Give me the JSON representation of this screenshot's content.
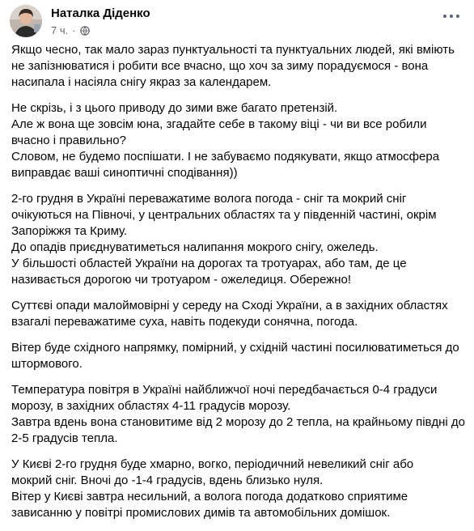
{
  "post": {
    "author": "Наталка Діденко",
    "time": "7 ч.",
    "separator": "·",
    "paragraphs": [
      [
        "Якщо чесно, так мало зараз пунктуальності та пунктуальних людей, які вміють",
        "не запізнюватися і робити все вчасно, що хоч за зиму порадуємося - вона",
        "насипала і насіяла снігу якраз за календарем."
      ],
      [
        "Не скрізь, і з цього приводу до зими вже багато претензій.",
        "Але ж вона ще зовсім юна, згадайте себе в такому віці - чи ви все робили",
        "вчасно і правильно?",
        "Словом, не будемо поспішати. І не забуваємо подякувати, якщо атмосфера",
        "виправдає ваші синоптичні сподівання))"
      ],
      [
        "2-го грудня в Україні переважатиме волога погода - сніг та мокрий сніг",
        "очікуються на Півночі, у центральних областях та у південній частині, окрім",
        "Запоріжжя та Криму.",
        "До опадів приєднуватиметься налипання мокрого снігу, ожеледь.",
        "У більшості областей України на дорогах та тротуарах, або там, де це",
        "називається дорогою чи тротуаром - ожеледиця. Обережно!"
      ],
      [
        "Суттєві опади малоймовірні у середу на Сході України, а в західних областях",
        "взагалі переважатиме суха, навіть подекуди сонячна, погода."
      ],
      [
        "Вітер буде східного напрямку, помірний, у східній частині посилюватиметься до",
        "штормового."
      ],
      [
        "Температура повітря в Україні найближчої ночі передбачається 0-4 градуси",
        "морозу, в західних областях 4-11 градусів морозу.",
        "Завтра вдень вона становитиме від 2 морозу до 2 тепла, на крайньому півдні до",
        "2-5 градусів тепла."
      ],
      [
        "У Києві 2-го грудня буде хмарно, вогко, періодичний невеликий сніг або",
        "мокрий сніг. Вночі до -1-4 градусів, вдень близько нуля.",
        "Вітер у Києві завтра несильний, а волога погода додатково сприятиме",
        "зависанню у повітрі промислових димів та автомобільних домішок."
      ]
    ]
  },
  "icons": {
    "globe": "globe-icon",
    "more": "more-options-icon"
  },
  "colors": {
    "text": "#050505",
    "secondary": "#65676b",
    "background": "#ffffff"
  }
}
